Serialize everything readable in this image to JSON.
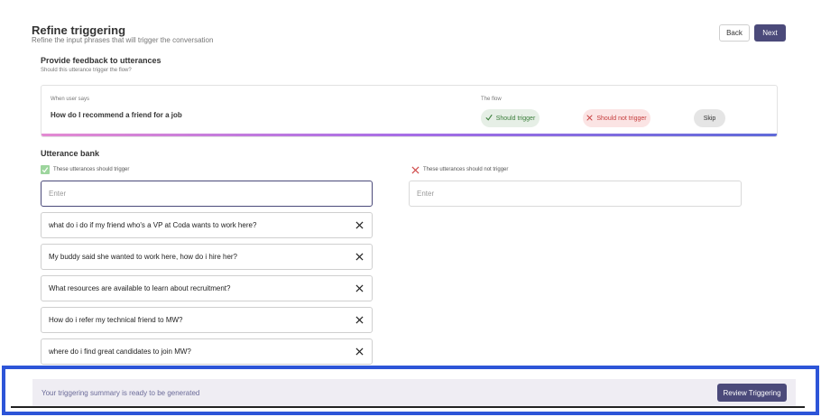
{
  "header": {
    "title": "Refine triggering",
    "subtitle": "Refine the input phrases that will trigger the conversation",
    "back_label": "Back",
    "next_label": "Next"
  },
  "feedback": {
    "title": "Provide feedback to utterances",
    "subtitle": "Should this utterance trigger the flow?",
    "when_label": "When user says",
    "utterance": "How do I recommend a friend for a job",
    "flow_label": "The flow",
    "should_trigger_label": "Should trigger",
    "should_not_trigger_label": "Should not trigger",
    "skip_label": "Skip"
  },
  "bank": {
    "title": "Utterance bank",
    "trigger_heading": "These utterances should trigger",
    "not_trigger_heading": "These utterances should not trigger",
    "trigger_placeholder": "Enter",
    "not_trigger_placeholder": "Enter",
    "trigger_items": [
      "what do i do if my friend who's a VP at Coda wants to work here?",
      "My buddy said she wanted to work here, how do i hire her?",
      "What resources are available to learn about recruitment?",
      "How do i refer my technical friend to MW?",
      "where do i find great candidates to join MW?"
    ]
  },
  "summary": {
    "text": "Your triggering summary is ready to be generated",
    "button_label": "Review Triggering"
  },
  "colors": {
    "accent": "#4b4a7a",
    "highlight_frame": "#2d55d8",
    "trigger_green": "#3a7d3a",
    "not_trigger_red": "#c53b3b"
  }
}
